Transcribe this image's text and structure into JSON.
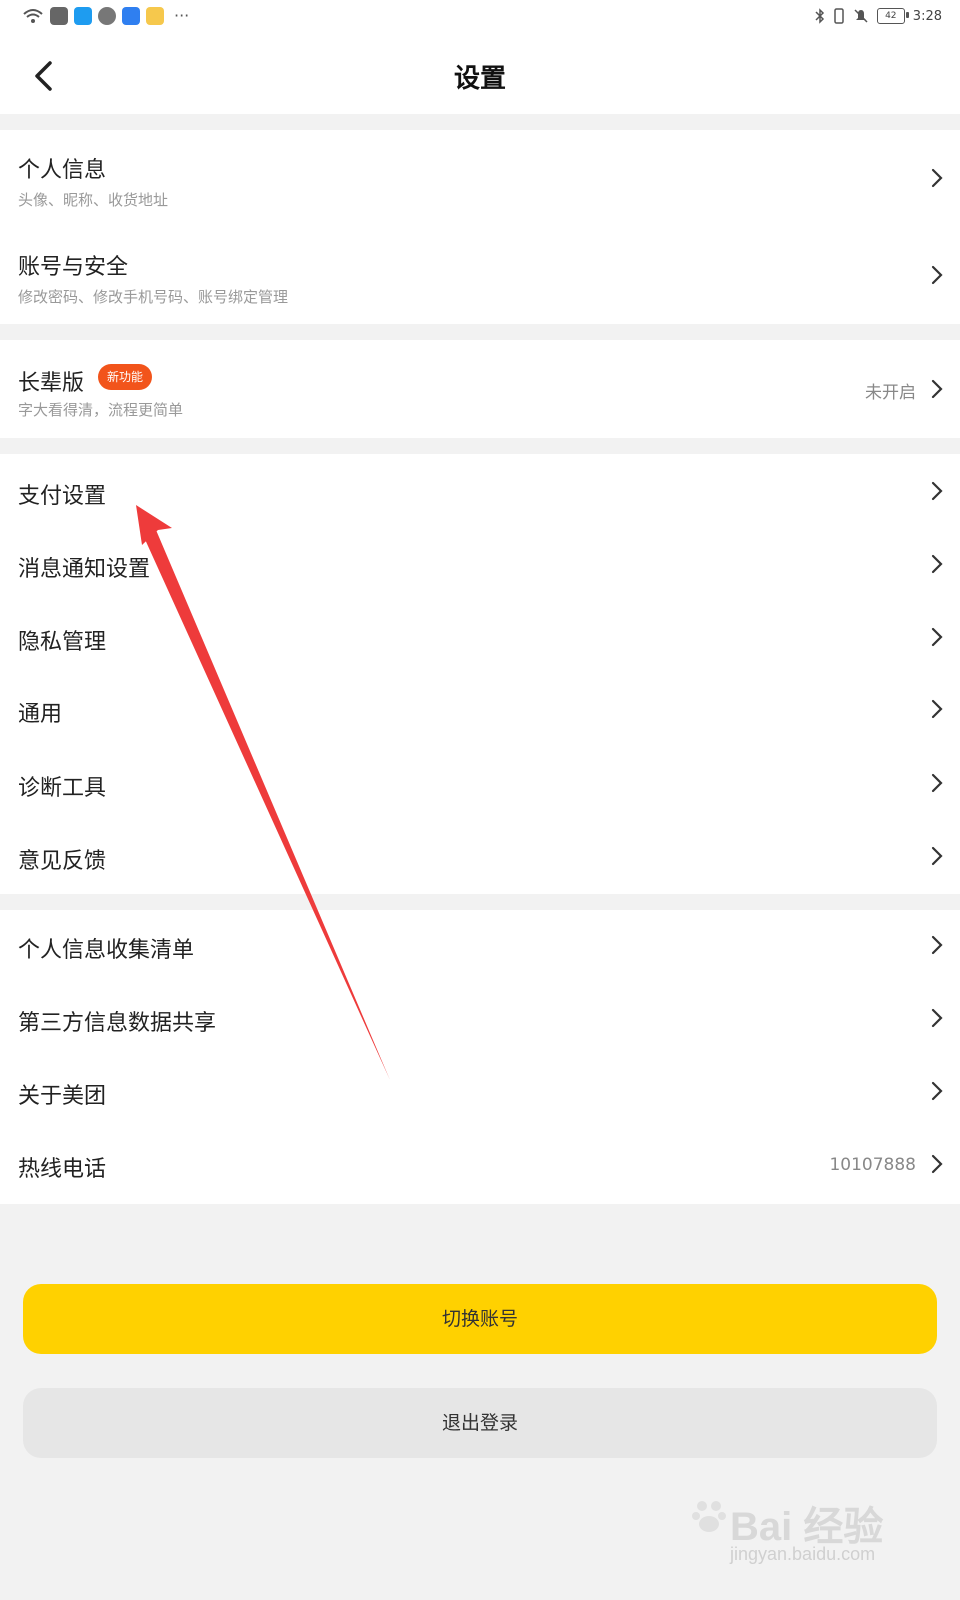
{
  "status_bar": {
    "time": "3:28",
    "battery": "42",
    "more": "···",
    "icons": [
      "wifi-icon",
      "app-icon",
      "search-app-icon",
      "wechat-icon",
      "cloud-icon",
      "weibo-icon",
      "bluetooth-icon",
      "vibrate-icon",
      "mute-icon",
      "battery-icon"
    ]
  },
  "nav": {
    "title": "设置"
  },
  "groups": [
    {
      "items": [
        {
          "title": "个人信息",
          "subtitle": "头像、昵称、收货地址"
        },
        {
          "title": "账号与安全",
          "subtitle": "修改密码、修改手机号码、账号绑定管理"
        }
      ]
    },
    {
      "items": [
        {
          "title": "长辈版",
          "badge": "新功能",
          "subtitle": "字大看得清，流程更简单",
          "value": "未开启"
        }
      ]
    },
    {
      "items": [
        {
          "title": "支付设置"
        },
        {
          "title": "消息通知设置"
        },
        {
          "title": "隐私管理"
        },
        {
          "title": "通用"
        },
        {
          "title": "诊断工具"
        },
        {
          "title": "意见反馈"
        }
      ]
    },
    {
      "items": [
        {
          "title": "个人信息收集清单"
        },
        {
          "title": "第三方信息数据共享"
        },
        {
          "title": "关于美团"
        },
        {
          "title": "热线电话",
          "value": "10107888"
        }
      ]
    }
  ],
  "buttons": {
    "switch_account": "切换账号",
    "logout": "退出登录"
  },
  "watermark": {
    "brand": "Bai 经验",
    "url": "jingyan.baidu.com"
  },
  "colors": {
    "accent": "#ffd100",
    "badge": "#f2541b",
    "annotation_arrow": "#ee3b3b"
  }
}
